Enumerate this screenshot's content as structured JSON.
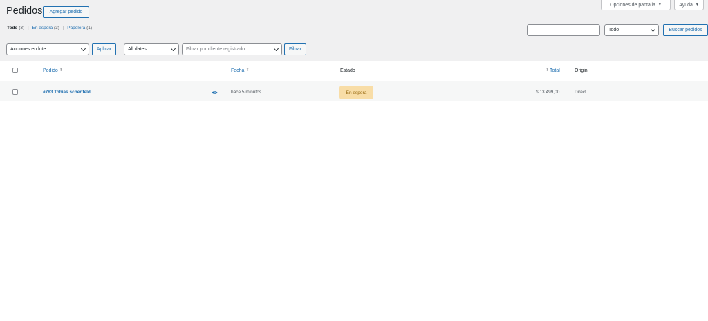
{
  "header": {
    "title": "Pedidos",
    "add_order_label": "Agregar pedido",
    "screen_options_label": "Opciones de pantalla",
    "help_label": "Ayuda",
    "dropdown_arrow": "▼"
  },
  "views": [
    {
      "label": "Todo",
      "count": "(3)"
    },
    {
      "label": "En espera",
      "count": "(3)"
    },
    {
      "label": "Papelera",
      "count": "(1)"
    }
  ],
  "search": {
    "value": "",
    "filter_selected": "Todo",
    "submit_label": "Buscar pedidos"
  },
  "toolbar": {
    "bulk_actions_selected": "Acciones en lote",
    "apply_label": "Aplicar",
    "dates_selected": "All dates",
    "customer_filter_placeholder": "Filtrar por cliente registrado",
    "filter_label": "Filtrar"
  },
  "table": {
    "columns": {
      "order": "Pedido",
      "date": "Fecha",
      "status": "Estado",
      "total": "Total",
      "origin": "Origin"
    },
    "rows": [
      {
        "order": "#783 Tobias schenfeld",
        "date": "hace 5 minutos",
        "status": "En espera",
        "total": "$ 13.499,00",
        "origin": "Direct"
      }
    ]
  },
  "colors": {
    "accent": "#2271b1",
    "background": "#f0f0f1",
    "status_on_hold_bg": "#f8dda7",
    "status_on_hold_text": "#94660c"
  },
  "icons": {
    "preview": "eye-icon",
    "sort": "sort-arrows-icon",
    "select": "chevron-down-icon"
  }
}
